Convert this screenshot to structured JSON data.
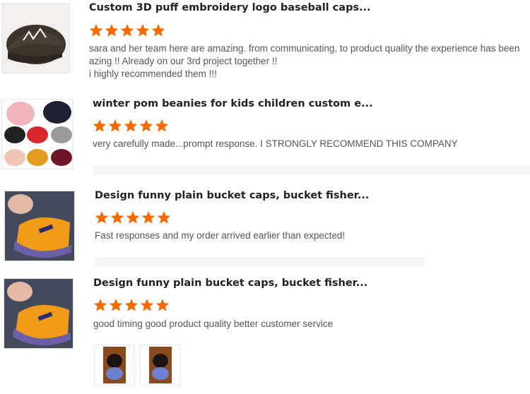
{
  "reviews": [
    {
      "title": "Custom 3D puff embroidery logo baseball caps...",
      "rating": 5,
      "text_lines": [
        "sara and her team here are amazing. from communicating,  to product quality the experience has been",
        "azing !! Already on our 3rd project together !!",
        "i highly recommended them !!!"
      ]
    },
    {
      "title": "winter pom beanies for kids children custom e...",
      "rating": 5,
      "text_lines": [
        "very carefully made...prompt response. I STRONGLY RECOMMEND THIS COMPANY"
      ]
    },
    {
      "title": "Design funny plain bucket caps, bucket fisher...",
      "rating": 5,
      "text_lines": [
        "Fast responses and my order arrived earlier than expected!"
      ]
    },
    {
      "title": "Design funny plain bucket caps, bucket fisher...",
      "rating": 5,
      "text_lines": [
        "good timing good product quality better customer service"
      ],
      "photos": 2
    }
  ],
  "colors": {
    "star": "#f56a00",
    "text": "#555555",
    "title": "#222222"
  }
}
